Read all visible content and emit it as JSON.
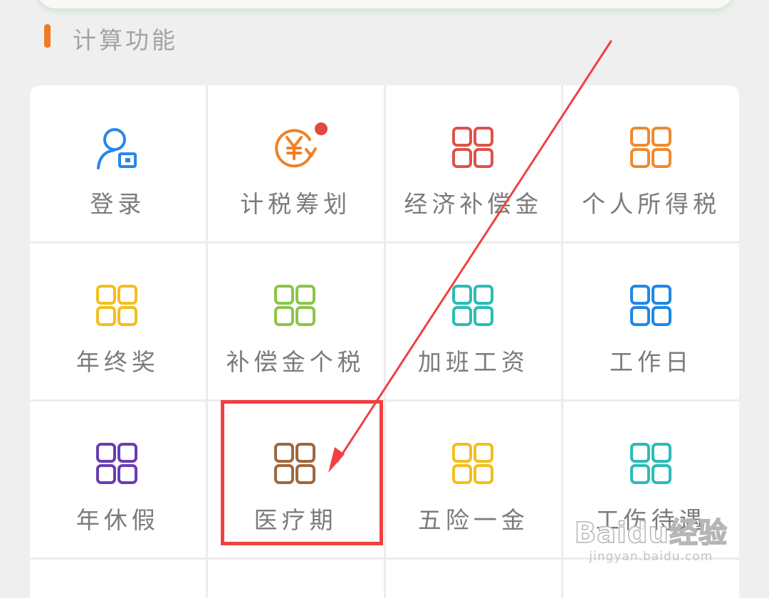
{
  "section": {
    "title": "计算功能"
  },
  "grid": {
    "items": [
      {
        "label": "登录",
        "icon": "user-card-icon",
        "color": "#2a86e8"
      },
      {
        "label": "计税筹划",
        "icon": "yuan-refresh-icon",
        "color": "#f08125",
        "badge_color": "#e04a3f"
      },
      {
        "label": "经济补偿金",
        "icon": "grid-icon",
        "color": "#dd5249"
      },
      {
        "label": "个人所得税",
        "icon": "grid-icon",
        "color": "#ef8a2e"
      },
      {
        "label": "年终奖",
        "icon": "grid-icon",
        "color": "#f3be1e"
      },
      {
        "label": "补偿金个税",
        "icon": "grid-icon",
        "color": "#8cc54a"
      },
      {
        "label": "加班工资",
        "icon": "grid-icon",
        "color": "#2bbcb6"
      },
      {
        "label": "工作日",
        "icon": "grid-icon",
        "color": "#1f88e5"
      },
      {
        "label": "年休假",
        "icon": "grid-icon",
        "color": "#6a3db5"
      },
      {
        "label": "医疗期",
        "icon": "grid-icon",
        "color": "#a0673f"
      },
      {
        "label": "五险一金",
        "icon": "grid-icon",
        "color": "#f3be1e"
      },
      {
        "label": "工伤待遇",
        "icon": "grid-icon",
        "color": "#2bbcb6"
      }
    ]
  },
  "annotation": {
    "highlight_color": "#f04141",
    "arrow_color": "#f04141"
  },
  "watermark": {
    "logo": "Baidu经验",
    "url": "jingyan.baidu.com"
  }
}
